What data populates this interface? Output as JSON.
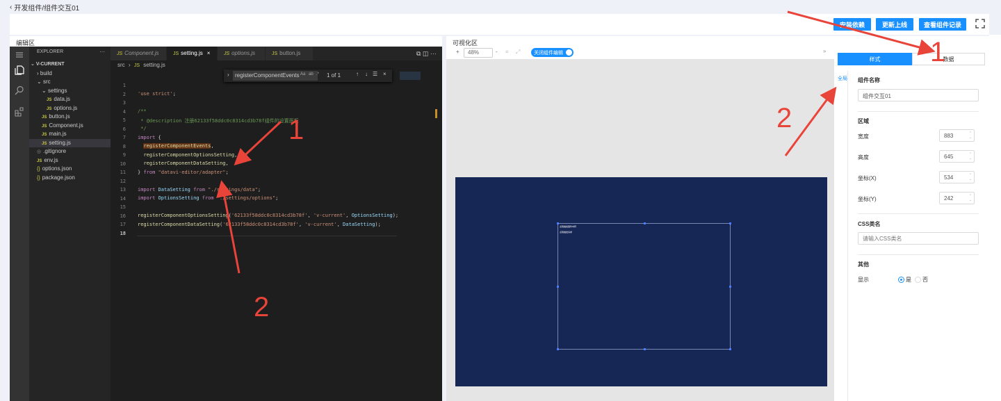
{
  "breadcrumb": {
    "back_icon": "chevron-left-icon",
    "text": "开发组件/组件交互01"
  },
  "toolbar": {
    "install_deps": "安装依赖",
    "update_online": "更新上线",
    "view_records": "查看组件记录",
    "fullscreen_icon": "fullscreen-icon"
  },
  "editor": {
    "section_label": "编辑区",
    "explorer_title": "EXPLORER",
    "project": "V-CURRENT",
    "tree": [
      {
        "label": "build",
        "type": "folder"
      },
      {
        "label": "src",
        "type": "folder-open"
      },
      {
        "label": "settings",
        "type": "folder-open"
      },
      {
        "label": "data.js",
        "type": "js"
      },
      {
        "label": "options.js",
        "type": "js"
      },
      {
        "label": "button.js",
        "type": "js"
      },
      {
        "label": "Component.js",
        "type": "js"
      },
      {
        "label": "main.js",
        "type": "js"
      },
      {
        "label": "setting.js",
        "type": "js"
      },
      {
        "label": ".gitignore",
        "type": "file"
      },
      {
        "label": "env.js",
        "type": "js"
      },
      {
        "label": "options.json",
        "type": "json"
      },
      {
        "label": "package.json",
        "type": "json"
      }
    ],
    "tabs": [
      "Component.js",
      "setting.js",
      "options.js",
      "button.js"
    ],
    "file_breadcrumb": {
      "folder": "src",
      "file": "setting.js"
    },
    "find": {
      "query": "registerComponentEvents",
      "match_case": "Aa",
      "whole_word": "ab",
      "regex": ".*",
      "result": "1 of 1"
    },
    "line_numbers": [
      "1",
      "2",
      "3",
      "4",
      "5",
      "6",
      "7",
      "8",
      "9",
      "10",
      "11",
      "12",
      "13",
      "14",
      "15",
      "16",
      "17",
      "18"
    ]
  },
  "visual": {
    "section_label": "可视化区",
    "zoom": "48%",
    "edit_toggle_label": "关闭组件编辑",
    "canvas_texts": [
      "点我触发事件中转",
      "点我触发请求"
    ]
  },
  "panel": {
    "tab_style": "样式",
    "tab_data": "数据",
    "side_tag": "全局",
    "component_name_label": "组件名称",
    "component_name_value": "组件交互01",
    "region_label": "区域",
    "width_label": "宽度",
    "width_value": "883",
    "height_label": "高度",
    "height_value": "645",
    "x_label": "坐标(X)",
    "x_value": "534",
    "y_label": "坐标(Y)",
    "y_value": "242",
    "css_label": "CSS类名",
    "css_placeholder": "请输入CSS类名",
    "other_label": "其他",
    "display_label": "显示",
    "yes": "是",
    "no": "否"
  },
  "annotations": [
    "1",
    "2",
    "1",
    "2"
  ],
  "colors": {
    "accent": "#1890ff",
    "canvas": "#162655",
    "annotation": "#e8443a"
  }
}
